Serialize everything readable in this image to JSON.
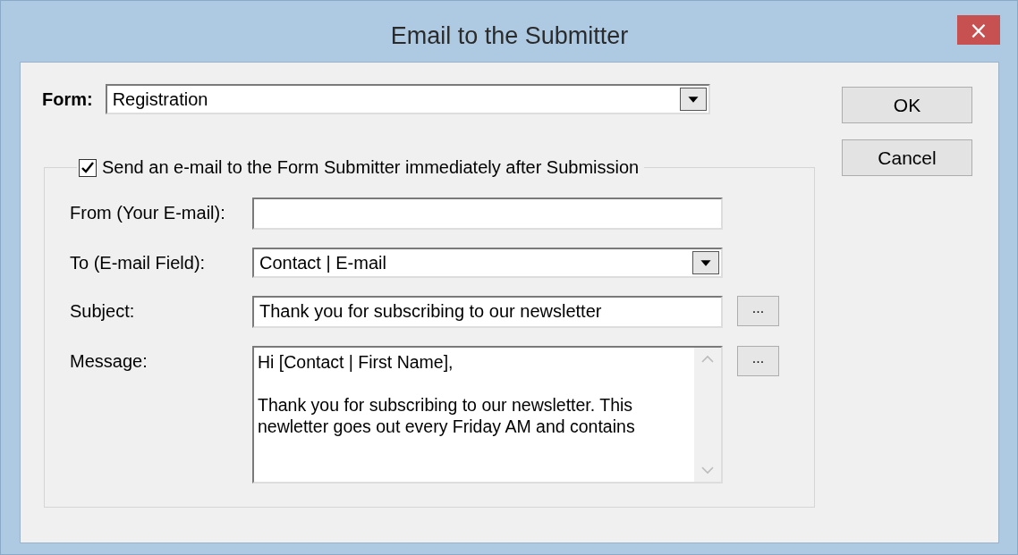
{
  "window": {
    "title": "Email to the Submitter",
    "close": "×"
  },
  "form": {
    "label": "Form:",
    "value": "Registration"
  },
  "buttons": [
    "OK",
    "Cancel"
  ],
  "group": {
    "checkbox": {
      "label": "Send an e-mail to the Form Submitter immediately after Submission",
      "checked": true
    },
    "fields": [
      {
        "kind": "text",
        "label": "From (Your E-mail):"
      },
      {
        "kind": "select",
        "label": "To (E-mail Field):",
        "value": "Contact | E-mail"
      },
      {
        "kind": "text",
        "label": "Subject:",
        "value": "Thank you for subscribing to our newsletter",
        "more": "..."
      },
      {
        "kind": "memo",
        "label": "Message:",
        "value": "Hi [Contact | First Name],\n\nThank you for subscribing to our newsletter. This newletter goes out every Friday AM and contains",
        "more": "..."
      }
    ]
  }
}
